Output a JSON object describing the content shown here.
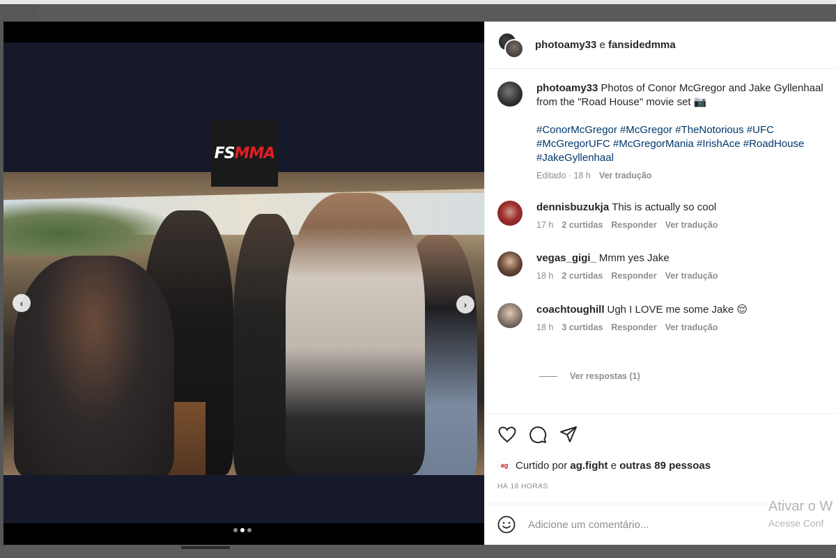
{
  "post": {
    "header": {
      "user1": "photoamy33",
      "joiner": "e",
      "user2": "fansidedmma"
    },
    "media": {
      "logo": {
        "part1": "FS",
        "part2": "MMA"
      },
      "prev_icon": "chevron-left-icon",
      "next_icon": "chevron-right-icon",
      "slides_total": 3,
      "active_slide": 2
    },
    "caption": {
      "username": "photoamy33",
      "text": "Photos of Conor McGregor and Jake Gyllenhaal from the \"Road House\" movie set 📷",
      "hashtags": "#ConorMcGregor #McGregor #TheNotorious #UFC #McGregorUFC #McGregorMania #IrishAce #RoadHouse #JakeGyllenhaal",
      "edited": "Editado · 18 h",
      "translate": "Ver tradução"
    },
    "comments": [
      {
        "username": "dennisbuzukja",
        "text": "This is actually so cool",
        "time": "17 h",
        "likes": "2 curtidas",
        "reply": "Responder",
        "translate": "Ver tradução"
      },
      {
        "username": "vegas_gigi_",
        "text": "Mmm yes Jake",
        "time": "18 h",
        "likes": "2 curtidas",
        "reply": "Responder",
        "translate": "Ver tradução"
      },
      {
        "username": "coachtoughill",
        "text": "Ugh I LOVE me some Jake 😌",
        "time": "18 h",
        "likes": "3 curtidas",
        "reply": "Responder",
        "translate": "Ver tradução"
      }
    ],
    "view_replies": "Ver respostas (1)",
    "liked_by": {
      "prefix": "Curtido por",
      "user": "ag.fight",
      "joiner": "e",
      "others": "outras 89 pessoas",
      "avatar_text": "ag"
    },
    "time_ago": "HÁ 18 HORAS",
    "add_comment": {
      "placeholder": "Adicione um comentário..."
    },
    "icons": {
      "like": "heart-icon",
      "comment": "comment-icon",
      "share": "share-icon",
      "emoji": "smiley-icon"
    }
  },
  "watermark": {
    "title": "Ativar o W",
    "subtitle": "Acesse Conf"
  },
  "colors": {
    "link": "#00376b",
    "muted": "#8e8e8e",
    "text": "#262626",
    "brand_red": "#e11f26"
  }
}
